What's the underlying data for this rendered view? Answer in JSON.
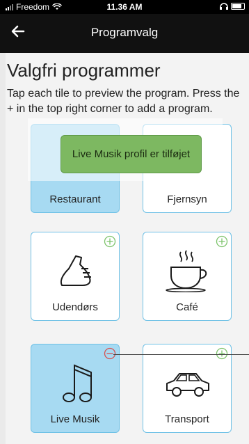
{
  "status_bar": {
    "carrier": "Freedom",
    "time": "11.36 AM"
  },
  "nav": {
    "title": "Programvalg"
  },
  "page": {
    "heading": "Valgfri programmer",
    "description": "Tap each tile to preview the program. Press the + in the top right corner to add a program."
  },
  "toast": {
    "message": "Live Musik profil er tilføjet"
  },
  "tiles": [
    {
      "label": "Restaurant",
      "selected": true,
      "action": "none"
    },
    {
      "label": "Fjernsyn",
      "selected": false,
      "action": "none"
    },
    {
      "label": "Udendørs",
      "selected": false,
      "action": "add"
    },
    {
      "label": "Café",
      "selected": false,
      "action": "add"
    },
    {
      "label": "Live Musik",
      "selected": true,
      "action": "remove"
    },
    {
      "label": "Transport",
      "selected": false,
      "action": "add"
    }
  ],
  "colors": {
    "tile_border": "#6fc1e6",
    "tile_selected_bg": "#a7daf2",
    "add_icon": "#7cc36a",
    "remove_icon": "#d8504f",
    "toast_bg": "#7db861"
  }
}
